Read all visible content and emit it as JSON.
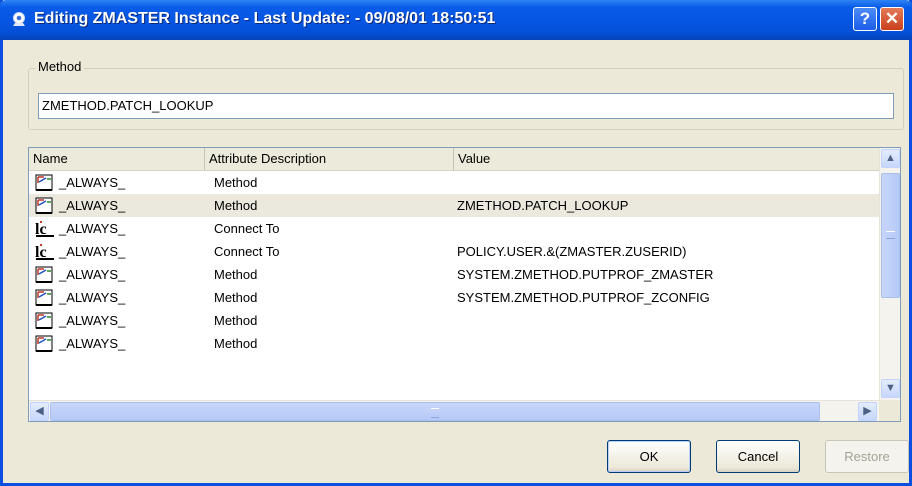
{
  "window": {
    "title": "Editing ZMASTER Instance - Last Update: - 09/08/01 18:50:51"
  },
  "method": {
    "legend": "Method",
    "value": "ZMETHOD.PATCH_LOOKUP"
  },
  "table": {
    "columns": [
      "Name",
      "Attribute Description",
      "Value"
    ],
    "rows": [
      {
        "icon": "method-icon",
        "name": "_ALWAYS_",
        "attr": "Method",
        "value": ""
      },
      {
        "icon": "method-icon",
        "name": "_ALWAYS_",
        "attr": "Method",
        "value": "ZMETHOD.PATCH_LOOKUP",
        "selected": true
      },
      {
        "icon": "connect-icon",
        "name": "_ALWAYS_",
        "attr": "Connect To",
        "value": ""
      },
      {
        "icon": "connect-icon",
        "name": "_ALWAYS_",
        "attr": "Connect To",
        "value": "POLICY.USER.&(ZMASTER.ZUSERID)"
      },
      {
        "icon": "method-icon",
        "name": "_ALWAYS_",
        "attr": "Method",
        "value": "SYSTEM.ZMETHOD.PUTPROF_ZMASTER"
      },
      {
        "icon": "method-icon",
        "name": "_ALWAYS_",
        "attr": "Method",
        "value": "SYSTEM.ZMETHOD.PUTPROF_ZCONFIG"
      },
      {
        "icon": "method-icon",
        "name": "_ALWAYS_",
        "attr": "Method",
        "value": ""
      },
      {
        "icon": "method-icon",
        "name": "_ALWAYS_",
        "attr": "Method",
        "value": ""
      }
    ]
  },
  "buttons": {
    "ok": "OK",
    "cancel": "Cancel",
    "restore": "Restore"
  },
  "colors": {
    "titlebar": "#0656e3",
    "selected_row": "#ebe9de",
    "window_face": "#ece9d8"
  }
}
